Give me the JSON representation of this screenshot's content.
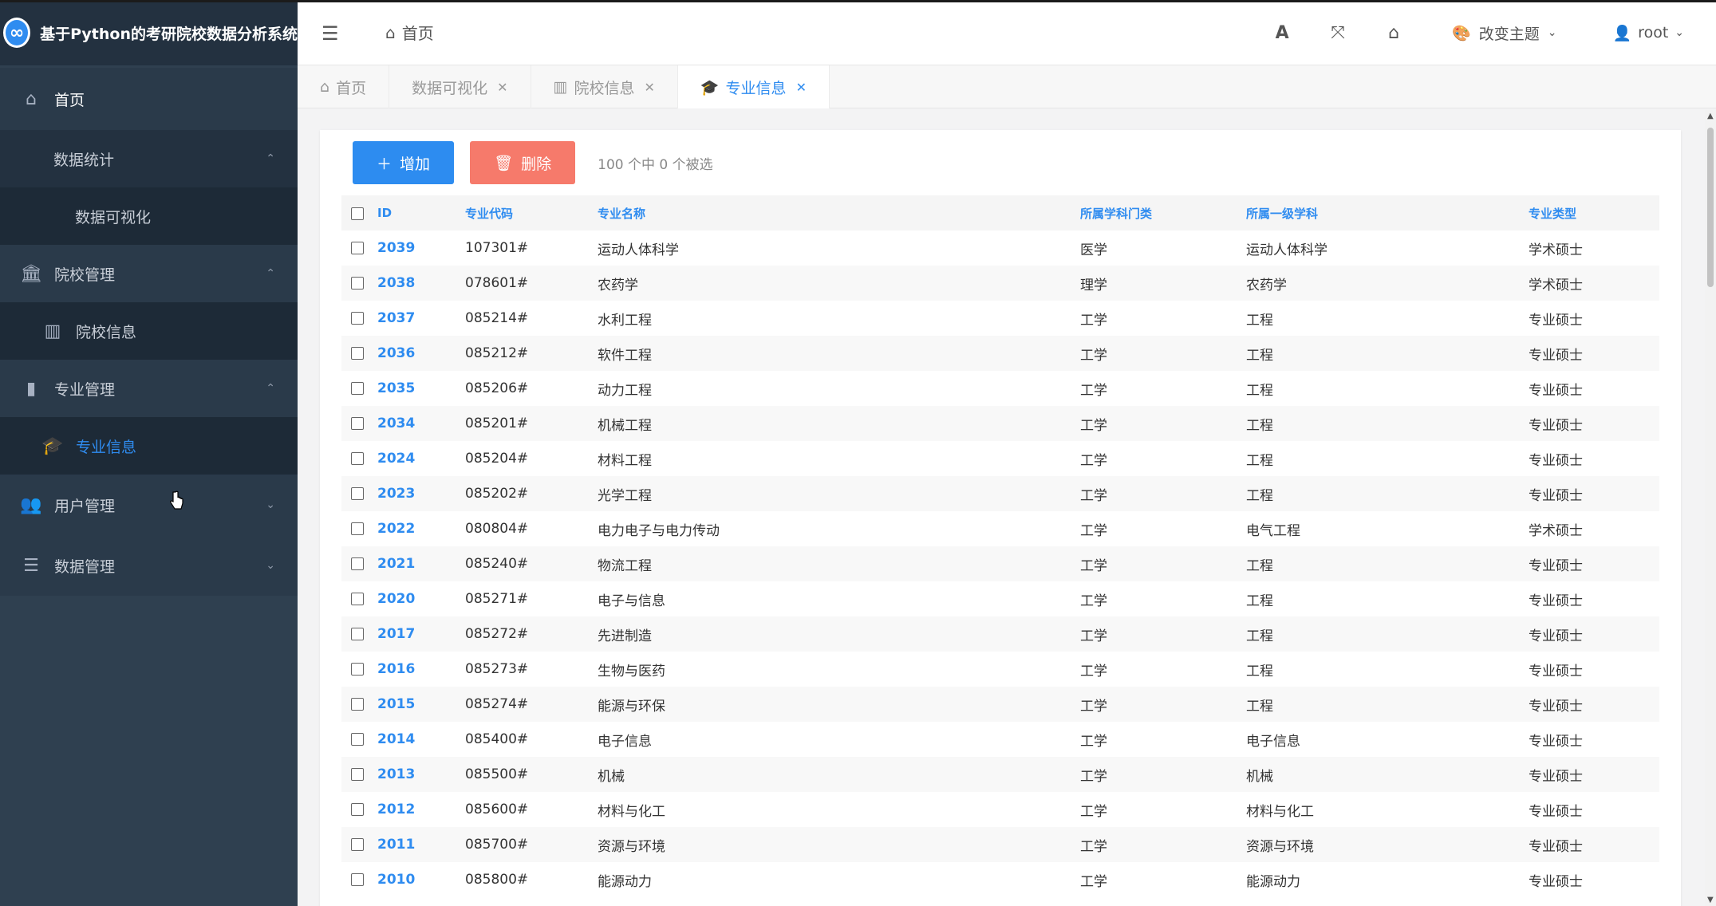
{
  "app": {
    "title": "基于Python的考研院校数据分析系统"
  },
  "sidebar": {
    "home": "首页",
    "stats": "数据统计",
    "viz": "数据可视化",
    "school_mgmt": "院校管理",
    "school_info": "院校信息",
    "major_mgmt": "专业管理",
    "major_info": "专业信息",
    "user_mgmt": "用户管理",
    "data_mgmt": "数据管理"
  },
  "header": {
    "home": "首页",
    "theme": "改变主题",
    "user": "root"
  },
  "tabs": [
    {
      "label": "首页"
    },
    {
      "label": "数据可视化"
    },
    {
      "label": "院校信息"
    },
    {
      "label": "专业信息"
    }
  ],
  "toolbar": {
    "add": "增加",
    "delete": "删除",
    "selection": "100 个中 0 个被选"
  },
  "table": {
    "headers": [
      "ID",
      "专业代码",
      "专业名称",
      "所属学科门类",
      "所属一级学科",
      "专业类型"
    ],
    "rows": [
      [
        "2039",
        "107301#",
        "运动人体科学",
        "医学",
        "运动人体科学",
        "学术硕士"
      ],
      [
        "2038",
        "078601#",
        "农药学",
        "理学",
        "农药学",
        "学术硕士"
      ],
      [
        "2037",
        "085214#",
        "水利工程",
        "工学",
        "工程",
        "专业硕士"
      ],
      [
        "2036",
        "085212#",
        "软件工程",
        "工学",
        "工程",
        "专业硕士"
      ],
      [
        "2035",
        "085206#",
        "动力工程",
        "工学",
        "工程",
        "专业硕士"
      ],
      [
        "2034",
        "085201#",
        "机械工程",
        "工学",
        "工程",
        "专业硕士"
      ],
      [
        "2024",
        "085204#",
        "材料工程",
        "工学",
        "工程",
        "专业硕士"
      ],
      [
        "2023",
        "085202#",
        "光学工程",
        "工学",
        "工程",
        "专业硕士"
      ],
      [
        "2022",
        "080804#",
        "电力电子与电力传动",
        "工学",
        "电气工程",
        "学术硕士"
      ],
      [
        "2021",
        "085240#",
        "物流工程",
        "工学",
        "工程",
        "专业硕士"
      ],
      [
        "2020",
        "085271#",
        "电子与信息",
        "工学",
        "工程",
        "专业硕士"
      ],
      [
        "2017",
        "085272#",
        "先进制造",
        "工学",
        "工程",
        "专业硕士"
      ],
      [
        "2016",
        "085273#",
        "生物与医药",
        "工学",
        "工程",
        "专业硕士"
      ],
      [
        "2015",
        "085274#",
        "能源与环保",
        "工学",
        "工程",
        "专业硕士"
      ],
      [
        "2014",
        "085400#",
        "电子信息",
        "工学",
        "电子信息",
        "专业硕士"
      ],
      [
        "2013",
        "085500#",
        "机械",
        "工学",
        "机械",
        "专业硕士"
      ],
      [
        "2012",
        "085600#",
        "材料与化工",
        "工学",
        "材料与化工",
        "专业硕士"
      ],
      [
        "2011",
        "085700#",
        "资源与环境",
        "工学",
        "资源与环境",
        "专业硕士"
      ],
      [
        "2010",
        "085800#",
        "能源动力",
        "工学",
        "能源动力",
        "专业硕士"
      ]
    ]
  },
  "colors": {
    "accent": "#2d8cf0",
    "danger": "#f67a6b",
    "sidebar": "#2f4050"
  }
}
